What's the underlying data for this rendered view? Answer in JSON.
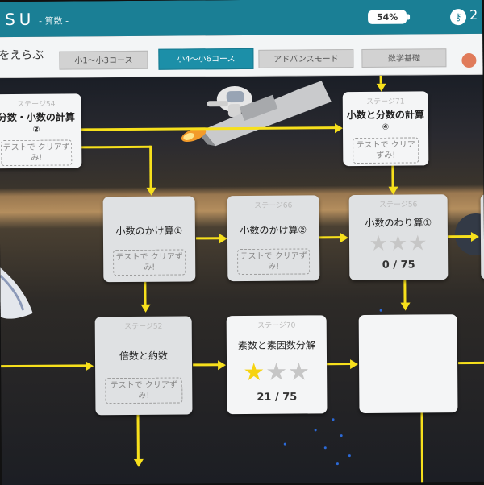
{
  "header": {
    "brand": "SU",
    "subject": "- 算数 -",
    "battery": "54%",
    "user_count": "2"
  },
  "tabs_bar": {
    "title": "をえらぶ",
    "tabs": [
      {
        "label": "小1〜小3コース",
        "active": false
      },
      {
        "label": "小4〜小6コース",
        "active": true
      },
      {
        "label": "アドバンスモード",
        "active": false
      },
      {
        "label": "数学基礎",
        "active": false
      }
    ]
  },
  "icons": {
    "key": "key-icon",
    "scroll_top": "scroll-top-icon"
  },
  "colors": {
    "header": "#1a7f95",
    "active_tab": "#1c8fa8",
    "connector": "#f7e01c",
    "star_on": "#f6d312",
    "star_off": "#c6c6c6"
  },
  "cards": {
    "s54": {
      "stage": "ステージ54",
      "title": "分数・小数の計算",
      "num": "②",
      "cleared": "テストで クリアずみ!"
    },
    "s71": {
      "stage": "ステージ71",
      "title": "小数と分数の計算",
      "num": "④",
      "cleared": "テストで クリアずみ!"
    },
    "s_k1": {
      "title": "小数のかけ算①",
      "cleared": "テストで クリアずみ!"
    },
    "s66": {
      "stage": "ステージ66",
      "title": "小数のかけ算②",
      "cleared": "テストで クリアずみ!"
    },
    "s_w1": {
      "stage": "ステージ56",
      "title": "小数のわり算①",
      "stars_earned": 0,
      "stars_total": 3,
      "progress": "0 / 75"
    },
    "s_b": {
      "stage": "ステージ52",
      "title": "倍数と約数",
      "cleared": "テストで クリアずみ!"
    },
    "s_p": {
      "stage": "ステージ70",
      "title": "素数と素因数分解",
      "stars_earned": 1,
      "stars_total": 3,
      "progress": "21 / 75"
    }
  }
}
